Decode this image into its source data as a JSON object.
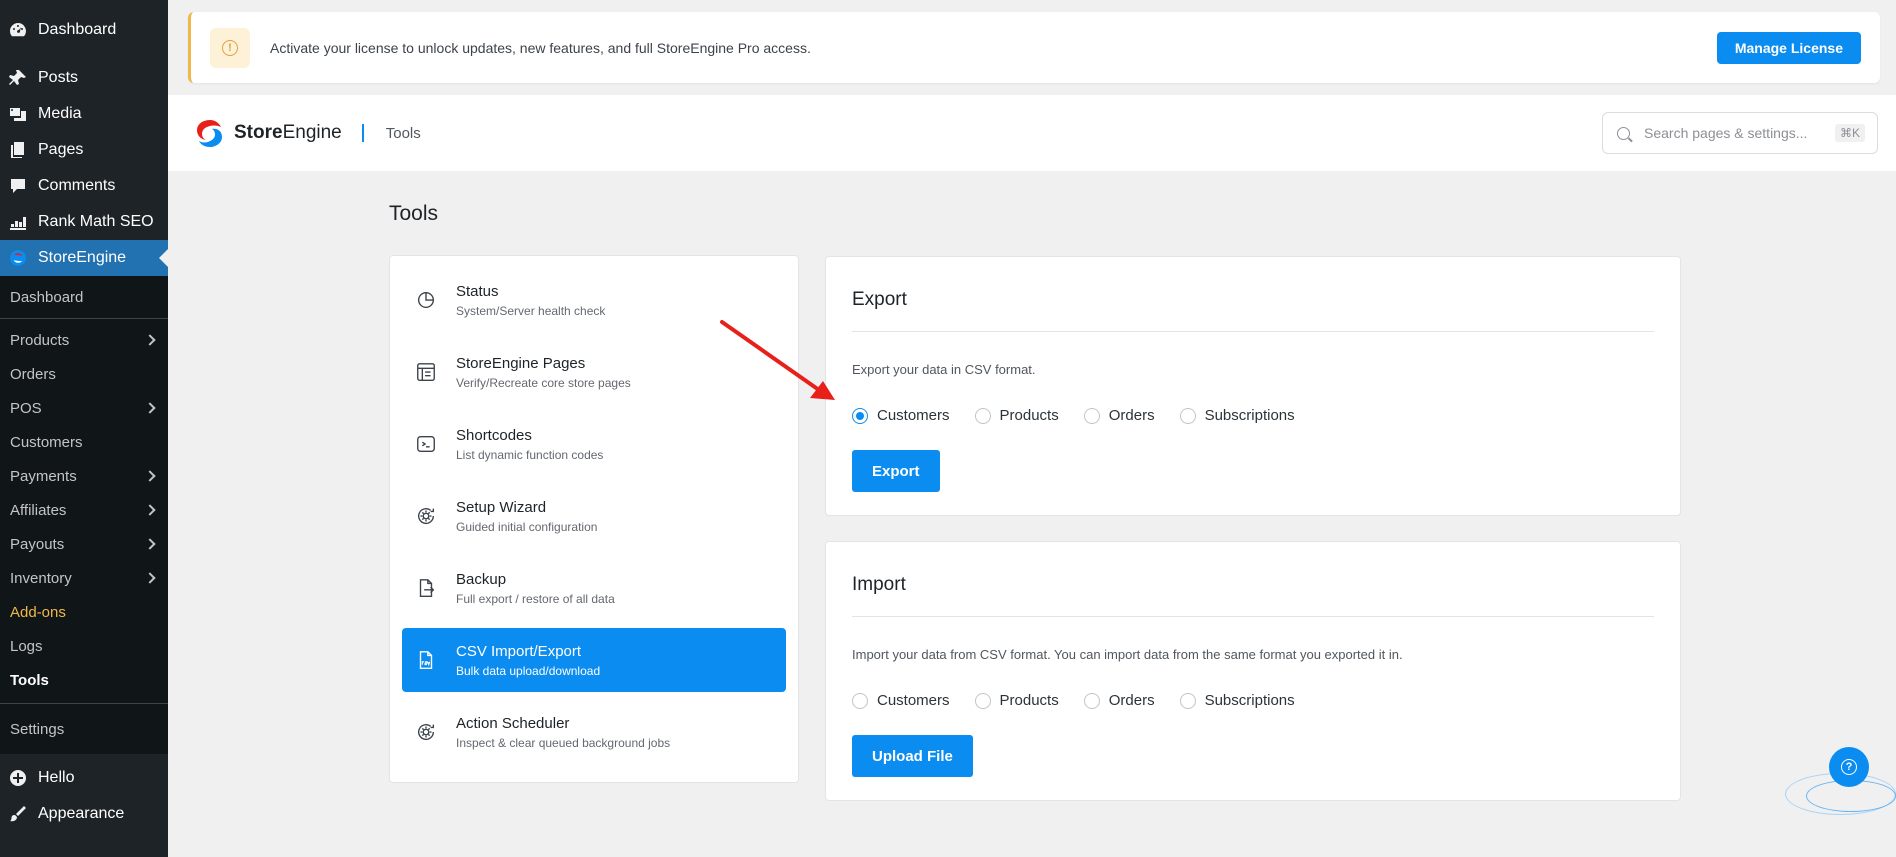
{
  "sidebar": {
    "top_items": [
      {
        "label": "Dashboard",
        "icon": "dashboard-icon"
      },
      {
        "label": "Posts",
        "icon": "pin-icon"
      },
      {
        "label": "Media",
        "icon": "media-icon"
      },
      {
        "label": "Pages",
        "icon": "pages-icon"
      },
      {
        "label": "Comments",
        "icon": "comment-icon"
      },
      {
        "label": "Rank Math SEO",
        "icon": "chart-icon"
      },
      {
        "label": "StoreEngine",
        "icon": "storeengine-icon"
      }
    ],
    "sub_items": [
      {
        "label": "Dashboard"
      },
      {
        "label": "Products"
      },
      {
        "label": "Orders"
      },
      {
        "label": "POS"
      },
      {
        "label": "Customers"
      },
      {
        "label": "Payments"
      },
      {
        "label": "Affiliates"
      },
      {
        "label": "Payouts"
      },
      {
        "label": "Inventory"
      },
      {
        "label": "Add-ons"
      },
      {
        "label": "Logs"
      },
      {
        "label": "Tools"
      },
      {
        "label": "Settings"
      }
    ],
    "bottom_items": [
      {
        "label": "Hello",
        "icon": "plus-circle-icon"
      },
      {
        "label": "Appearance",
        "icon": "brush-icon"
      }
    ]
  },
  "notice": {
    "message": "Activate your license to unlock updates, new features, and full StoreEngine Pro access.",
    "button": "Manage License",
    "icon_glyph": "!"
  },
  "header": {
    "brand_bold": "Store",
    "brand_rest": "Engine",
    "breadcrumb": "Tools",
    "search_placeholder": "Search pages & settings...",
    "shortcut": "⌘K"
  },
  "page_title": "Tools",
  "tools": [
    {
      "title": "Status",
      "subtitle": "System/Server health check",
      "icon": "pie-chart-icon"
    },
    {
      "title": "StoreEngine Pages",
      "subtitle": "Verify/Recreate core store pages",
      "icon": "page-layout-icon"
    },
    {
      "title": "Shortcodes",
      "subtitle": "List dynamic function codes",
      "icon": "terminal-icon"
    },
    {
      "title": "Setup Wizard",
      "subtitle": "Guided initial configuration",
      "icon": "gear-cycle-icon"
    },
    {
      "title": "Backup",
      "subtitle": "Full export / restore of all data",
      "icon": "file-export-icon"
    },
    {
      "title": "CSV Import/Export",
      "subtitle": "Bulk data upload/download",
      "icon": "csv-file-icon",
      "active": true
    },
    {
      "title": "Action Scheduler",
      "subtitle": "Inspect & clear queued background jobs",
      "icon": "gear-cycle-icon"
    }
  ],
  "export": {
    "title": "Export",
    "description": "Export your data in CSV format.",
    "options": [
      "Customers",
      "Products",
      "Orders",
      "Subscriptions"
    ],
    "selected": "Customers",
    "button": "Export"
  },
  "import": {
    "title": "Import",
    "description": "Import your data from CSV format. You can import data from the same format you exported it in.",
    "options": [
      "Customers",
      "Products",
      "Orders",
      "Subscriptions"
    ],
    "button": "Upload File"
  },
  "help_glyph": "?",
  "colors": {
    "accent": "#0b8cf0",
    "wp_sidebar": "#1d2327",
    "wp_active": "#2271b1",
    "notice_border": "#f0b849",
    "arrow": "#e8201a"
  }
}
